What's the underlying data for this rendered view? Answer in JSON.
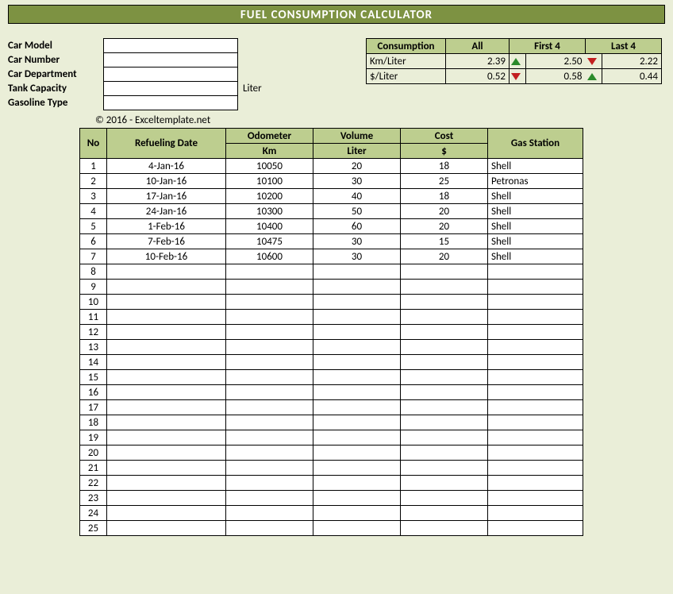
{
  "title": "FUEL CONSUMPTION CALCULATOR",
  "form": {
    "labels": {
      "model": "Car Model",
      "number": "Car Number",
      "department": "Car Department",
      "tank": "Tank Capacity",
      "gasoline": "Gasoline Type"
    },
    "values": {
      "model": "",
      "number": "",
      "department": "",
      "tank": "",
      "gasoline": ""
    },
    "tank_unit": "Liter"
  },
  "consumption": {
    "headers": {
      "main": "Consumption",
      "all": "All",
      "first4": "First 4",
      "last4": "Last 4"
    },
    "rows": [
      {
        "metric": "Km/Liter",
        "all": "2.39",
        "first4": "2.50",
        "first4_arrow": "up",
        "last4": "2.22",
        "last4_arrow": "down"
      },
      {
        "metric": "$/Liter",
        "all": "0.52",
        "first4": "0.58",
        "first4_arrow": "down",
        "last4": "0.44",
        "last4_arrow": "up"
      }
    ]
  },
  "copyright": "© 2016 - Exceltemplate.net",
  "table": {
    "headers": {
      "no": "No",
      "date": "Refueling Date",
      "odo": "Odometer",
      "vol": "Volume",
      "cost": "Cost",
      "station": "Gas Station",
      "odo_unit": "Km",
      "vol_unit": "Liter",
      "cost_unit": "$"
    },
    "rows": [
      {
        "no": 1,
        "date": "4-Jan-16",
        "odo": "10050",
        "vol": "20",
        "cost": "18",
        "station": "Shell"
      },
      {
        "no": 2,
        "date": "10-Jan-16",
        "odo": "10100",
        "vol": "30",
        "cost": "25",
        "station": "Petronas"
      },
      {
        "no": 3,
        "date": "17-Jan-16",
        "odo": "10200",
        "vol": "40",
        "cost": "18",
        "station": "Shell"
      },
      {
        "no": 4,
        "date": "24-Jan-16",
        "odo": "10300",
        "vol": "50",
        "cost": "20",
        "station": "Shell"
      },
      {
        "no": 5,
        "date": "1-Feb-16",
        "odo": "10400",
        "vol": "60",
        "cost": "20",
        "station": "Shell"
      },
      {
        "no": 6,
        "date": "7-Feb-16",
        "odo": "10475",
        "vol": "30",
        "cost": "15",
        "station": "Shell"
      },
      {
        "no": 7,
        "date": "10-Feb-16",
        "odo": "10600",
        "vol": "30",
        "cost": "20",
        "station": "Shell"
      },
      {
        "no": 8
      },
      {
        "no": 9
      },
      {
        "no": 10
      },
      {
        "no": 11
      },
      {
        "no": 12
      },
      {
        "no": 13
      },
      {
        "no": 14
      },
      {
        "no": 15
      },
      {
        "no": 16
      },
      {
        "no": 17
      },
      {
        "no": 18
      },
      {
        "no": 19
      },
      {
        "no": 20
      },
      {
        "no": 21
      },
      {
        "no": 22
      },
      {
        "no": 23
      },
      {
        "no": 24
      },
      {
        "no": 25
      }
    ]
  }
}
